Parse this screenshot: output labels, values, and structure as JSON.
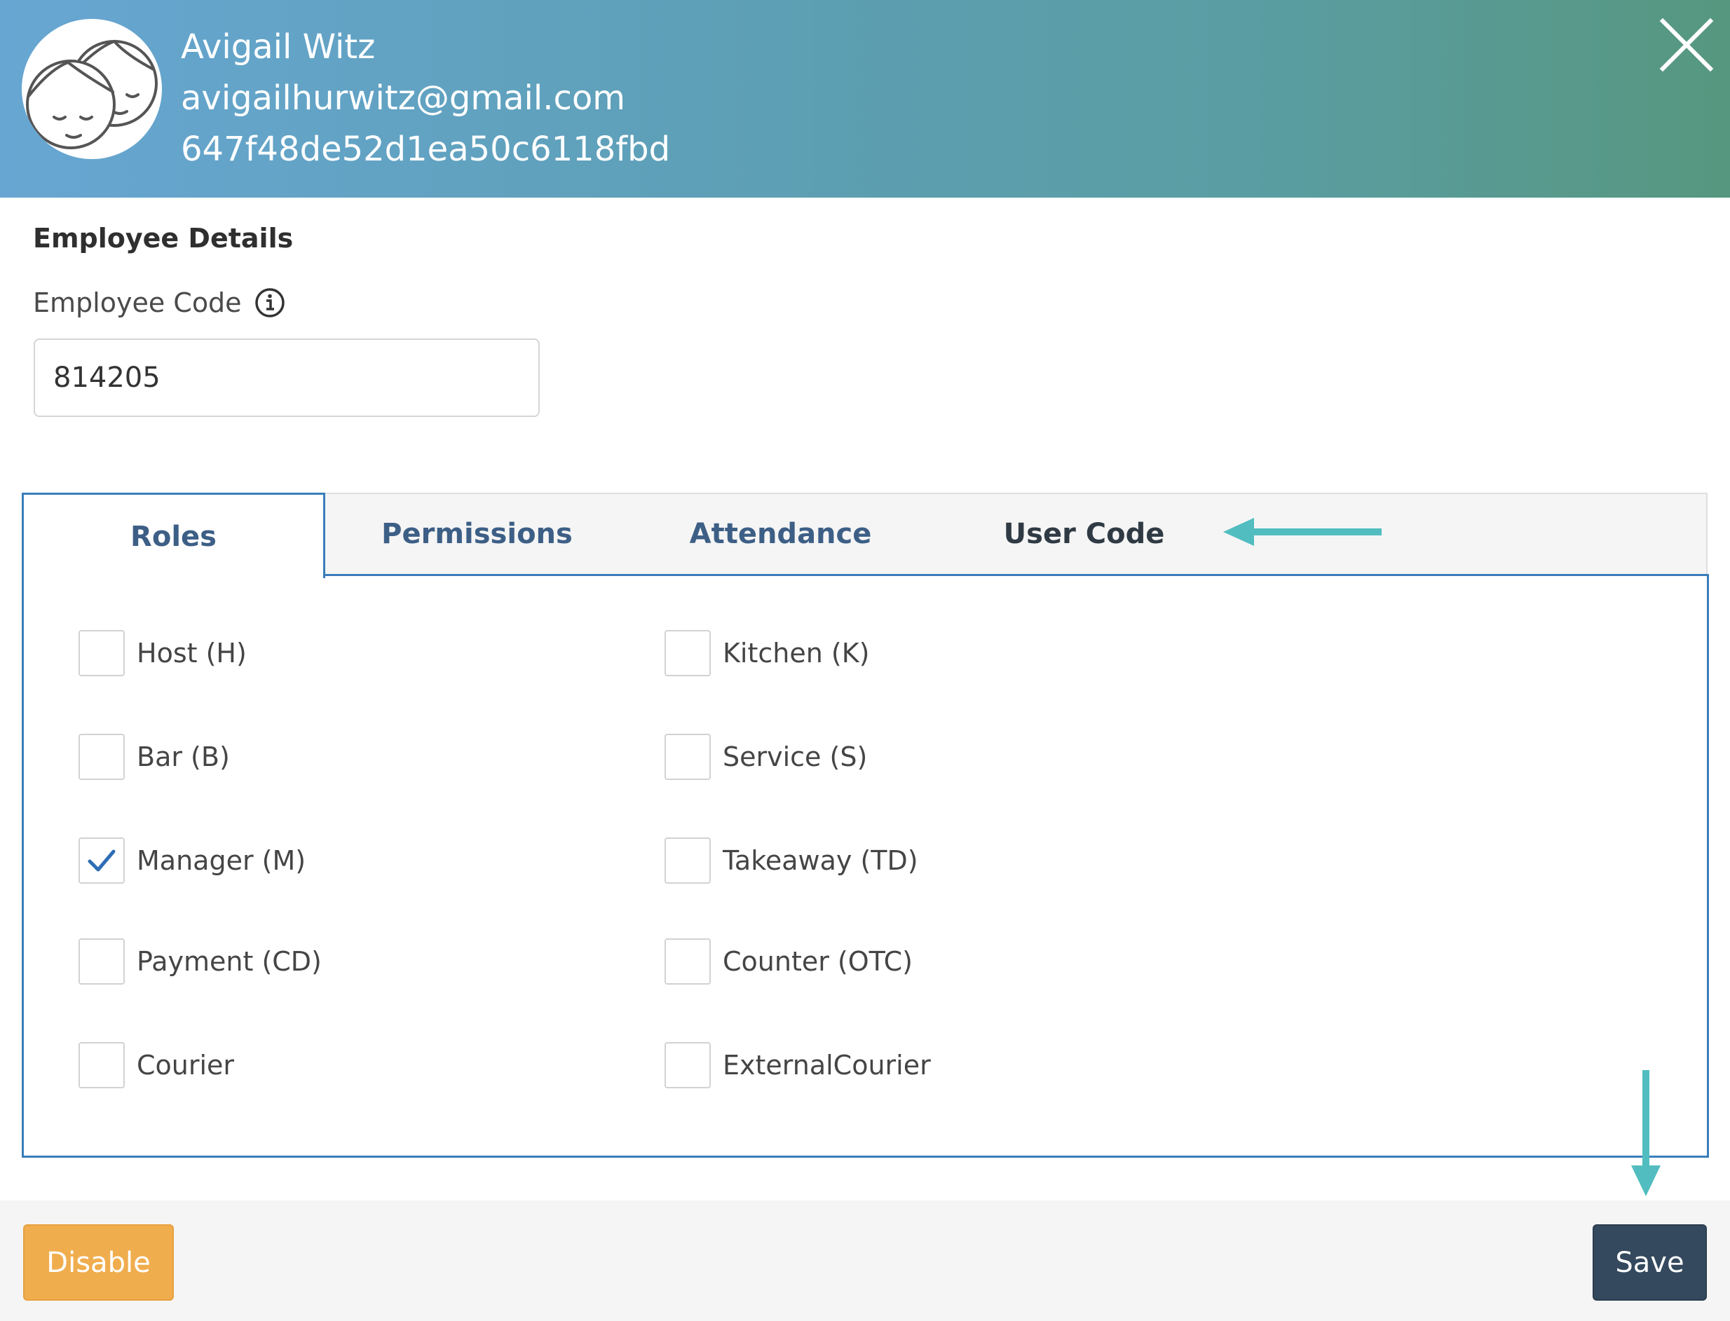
{
  "header": {
    "name": "Avigail Witz",
    "email": "avigailhurwitz@gmail.com",
    "user_id": "647f48de52d1ea50c6118fbd",
    "avatar_icon": "two-faces-avatar-icon",
    "close_icon": "close-icon"
  },
  "details": {
    "section_title": "Employee Details",
    "employee_code_label": "Employee Code",
    "info_icon": "info-icon",
    "employee_code_value": "814205"
  },
  "tabs": [
    {
      "label": "Roles",
      "active": true
    },
    {
      "label": "Permissions",
      "active": false
    },
    {
      "label": "Attendance",
      "active": false
    },
    {
      "label": "User Code",
      "active": false
    }
  ],
  "roles": {
    "items": [
      {
        "label": "Host (H)",
        "checked": false
      },
      {
        "label": "Kitchen (K)",
        "checked": false
      },
      {
        "label": "Bar (B)",
        "checked": false
      },
      {
        "label": "Service (S)",
        "checked": false
      },
      {
        "label": "Manager (M)",
        "checked": true
      },
      {
        "label": "Takeaway (TD)",
        "checked": false
      },
      {
        "label": "Payment (CD)",
        "checked": false
      },
      {
        "label": "Counter (OTC)",
        "checked": false
      },
      {
        "label": "Courier",
        "checked": false
      },
      {
        "label": "ExternalCourier",
        "checked": false
      }
    ]
  },
  "footer": {
    "disable_label": "Disable",
    "save_label": "Save"
  },
  "colors": {
    "header_gradient_start": "#67a6d2",
    "header_gradient_end": "#56977f",
    "tab_active_border": "#3a7dba",
    "tab_text": "#3d5f86",
    "checkmark": "#2f6db5",
    "annotation_arrow": "#52bdc0",
    "disable_button": "#f0ad4e",
    "save_button": "#34495e"
  }
}
